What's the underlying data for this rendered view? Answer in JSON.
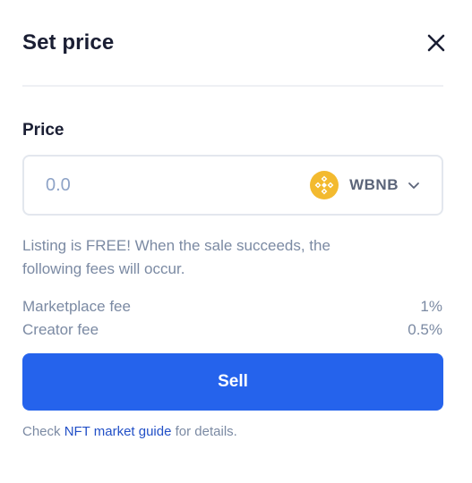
{
  "header": {
    "title": "Set price"
  },
  "price": {
    "label": "Price",
    "placeholder": "0.0",
    "currency": "WBNB",
    "currency_icon": "bnb-coin-icon",
    "coin_color": "#f3ba2f"
  },
  "notice": "Listing is FREE! When the sale succeeds, the following fees will occur.",
  "fees": [
    {
      "label": "Marketplace fee",
      "value": "1%"
    },
    {
      "label": "Creator fee",
      "value": "0.5%"
    }
  ],
  "sell_button": "Sell",
  "guide": {
    "prefix": "Check ",
    "link": "NFT market guide",
    "suffix": " for details."
  },
  "colors": {
    "primary": "#2563ec",
    "link": "#2250c7",
    "muted": "#7b8aa3"
  }
}
